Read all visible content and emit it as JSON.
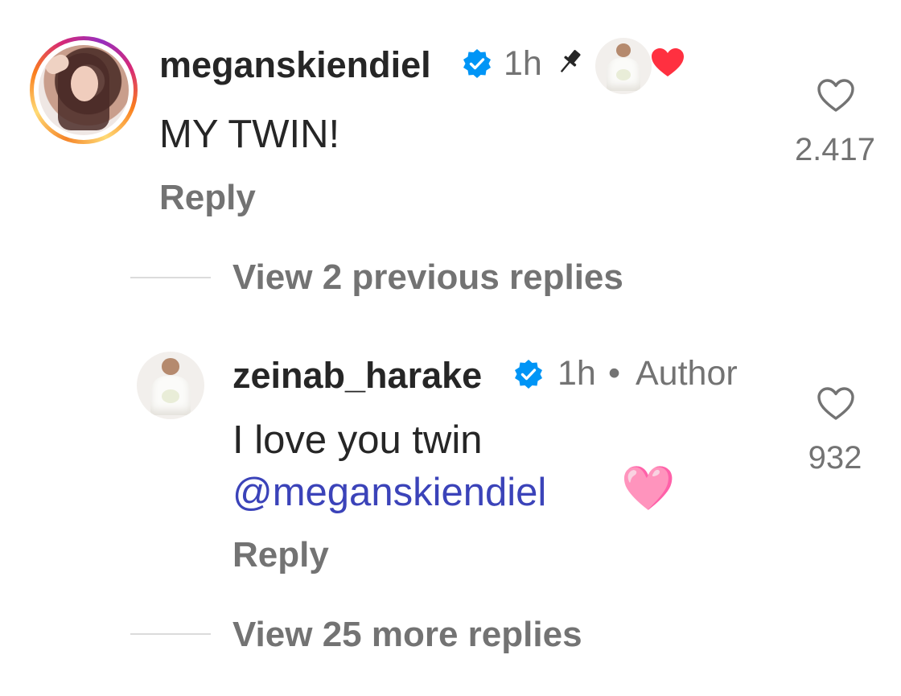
{
  "comments": [
    {
      "username": "meganskiendiel",
      "verified": true,
      "time": "1h",
      "pinned": true,
      "liked_by_author": true,
      "text": "MY TWIN!",
      "reply_label": "Reply",
      "like_count": "2.417",
      "view_replies_label": "View 2 previous replies"
    },
    {
      "username": "zeinab_harake",
      "verified": true,
      "time": "1h",
      "separator": "•",
      "badge": "Author",
      "text_line1": "I love you twin",
      "mention": "@meganskiendiel",
      "emoji": "🩷",
      "reply_label": "Reply",
      "like_count": "932",
      "view_replies_label": "View 25 more replies"
    }
  ],
  "colors": {
    "verified_blue": "#0095f6",
    "red_heart": "#ff3040",
    "mention_blue": "#3b43b9",
    "secondary_text": "#737373"
  },
  "icons": {
    "verified": "verified-badge-icon",
    "pin": "pin-icon",
    "like": "heart-outline-icon",
    "author_like": "heart-filled-icon",
    "threads": "threads-icon"
  }
}
